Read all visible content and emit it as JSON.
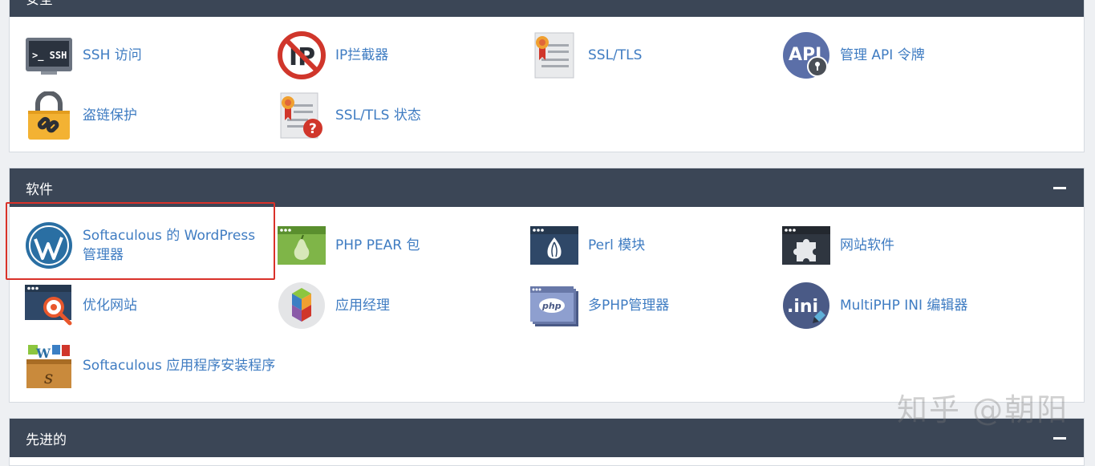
{
  "security": {
    "title": "安全",
    "items": [
      {
        "label": "SSH 访问",
        "icon": "ssh-terminal-icon"
      },
      {
        "label": "IP拦截器",
        "icon": "ip-blocker-icon"
      },
      {
        "label": "SSL/TLS",
        "icon": "ssl-certificate-icon"
      },
      {
        "label": "管理 API 令牌",
        "icon": "api-token-icon"
      },
      {
        "label": "盗链保护",
        "icon": "hotlink-lock-icon"
      },
      {
        "label": "SSL/TLS 状态",
        "icon": "ssl-status-icon"
      }
    ]
  },
  "software": {
    "title": "软件",
    "items": [
      {
        "label": "Softaculous 的 WordPress 管理器",
        "icon": "wordpress-icon"
      },
      {
        "label": "PHP PEAR 包",
        "icon": "php-pear-icon"
      },
      {
        "label": "Perl 模块",
        "icon": "perl-onion-icon"
      },
      {
        "label": "网站软件",
        "icon": "site-software-puzzle-icon"
      },
      {
        "label": "优化网站",
        "icon": "optimize-website-icon"
      },
      {
        "label": "应用经理",
        "icon": "application-manager-icon"
      },
      {
        "label": "多PHP管理器",
        "icon": "multiphp-manager-icon"
      },
      {
        "label": "MultiPHP INI 编辑器",
        "icon": "multiphp-ini-icon"
      },
      {
        "label": "Softaculous 应用程序安装程序",
        "icon": "softaculous-installer-icon"
      }
    ]
  },
  "advanced": {
    "title": "先进的"
  },
  "watermark": "知乎 @朝阳",
  "colors": {
    "header_bg": "#3b4656",
    "link": "#3f7cc2",
    "highlight": "#d9322a"
  }
}
